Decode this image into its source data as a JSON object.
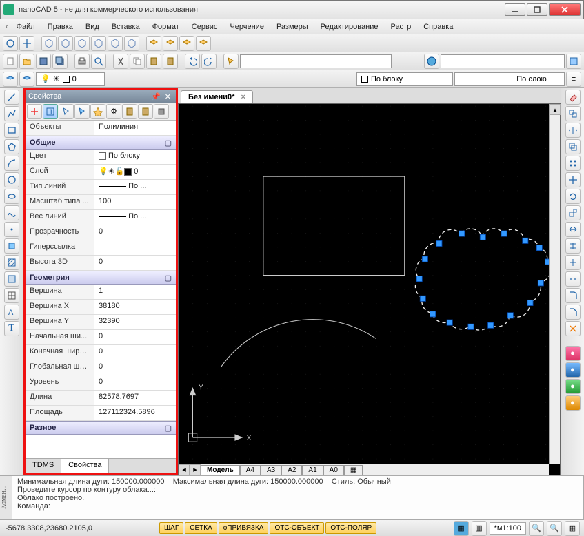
{
  "title": "nanoCAD 5 - не для коммерческого использования",
  "menu": [
    "Файл",
    "Правка",
    "Вид",
    "Вставка",
    "Формат",
    "Сервис",
    "Черчение",
    "Размеры",
    "Редактирование",
    "Растр",
    "Справка"
  ],
  "layer_current": "0",
  "combo_byblock": "По блоку",
  "combo_bylayer": "По слою",
  "doc_tab": "Без имени0*",
  "properties": {
    "title": "Свойства",
    "object_label": "Объекты",
    "object_value": "Полилиния",
    "sections": {
      "general": "Общие",
      "geometry": "Геометрия",
      "misc": "Разное"
    },
    "rows": {
      "color_l": "Цвет",
      "color_v": "По блоку",
      "layer_l": "Слой",
      "layer_v": "0",
      "ltype_l": "Тип линий",
      "ltype_v": "По ...",
      "ltscale_l": "Масштаб типа ...",
      "ltscale_v": "100",
      "lweight_l": "Вес линий",
      "lweight_v": "По ...",
      "transp_l": "Прозрачность",
      "transp_v": "0",
      "hyper_l": "Гиперссылка",
      "hyper_v": "",
      "h3d_l": "Высота 3D",
      "h3d_v": "0",
      "vertex_l": "Вершина",
      "vertex_v": "1",
      "vx_l": "Вершина X",
      "vx_v": "38180",
      "vy_l": "Вершина Y",
      "vy_v": "32390",
      "sw_l": "Начальная ши...",
      "sw_v": "0",
      "ew_l": "Конечная шири...",
      "ew_v": "0",
      "gw_l": "Глобальная ши...",
      "gw_v": "0",
      "lev_l": "Уровень",
      "lev_v": "0",
      "len_l": "Длина",
      "len_v": "82578.7697",
      "area_l": "Площадь",
      "area_v": "127112324.5896"
    },
    "tabs": {
      "tdms": "TDMS",
      "props": "Свойства"
    }
  },
  "model_tabs": [
    "Модель",
    "A4",
    "A3",
    "A2",
    "A1",
    "A0"
  ],
  "cmd": {
    "side": "Коман...",
    "l1a": "Минимальная длина дуги: 150000.000000",
    "l1b": "Максимальная длина дуги: 150000.000000",
    "l1c": "Стиль: Обычный",
    "l2": "Проведите курсор по контуру облака...:",
    "l3": "Облако построено.",
    "l4": "Команда:"
  },
  "status": {
    "coords": "-5678.3308,23680.2105,0",
    "toggles": [
      "ШАГ",
      "СЕТКА",
      "оПРИВЯЗКА",
      "ОТС-ОБЪЕКТ",
      "ОТС-ПОЛЯР"
    ],
    "scale": "*м1:100"
  },
  "axes": {
    "x": "X",
    "y": "Y"
  }
}
